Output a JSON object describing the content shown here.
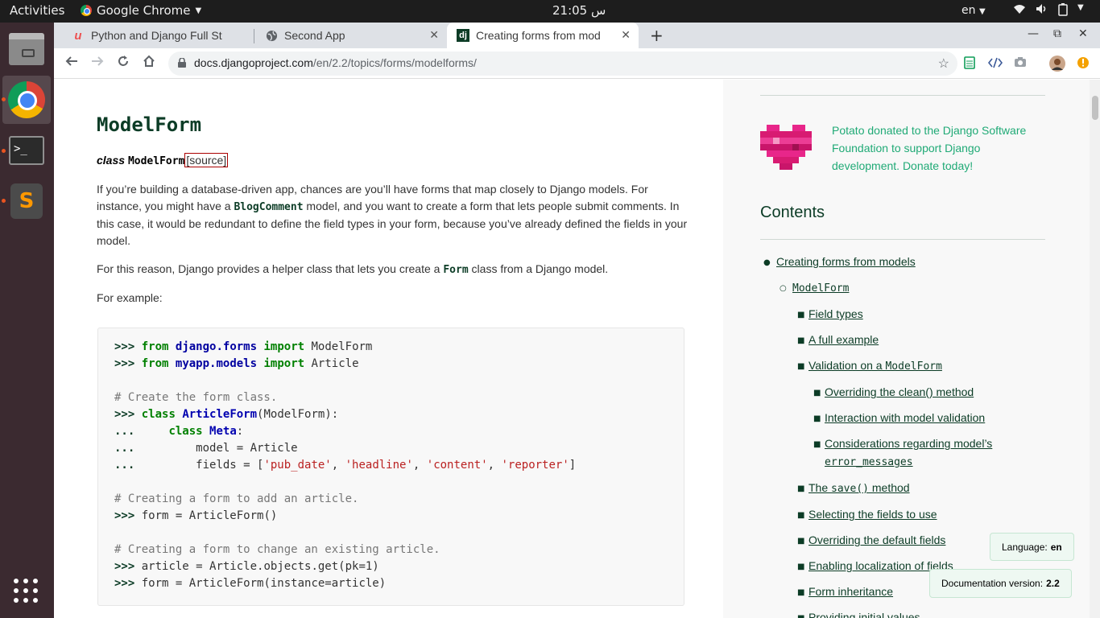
{
  "topbar": {
    "activities": "Activities",
    "app_name": "Google Chrome",
    "clock": "21:05 س",
    "lang": "en"
  },
  "browser": {
    "tabs": [
      {
        "title": "Python and Django Full St",
        "favicon": "udemy-icon"
      },
      {
        "title": "Second App",
        "favicon": "globe-icon"
      },
      {
        "title": "Creating forms from mod",
        "favicon": "django-icon"
      }
    ],
    "url_host": "docs.djangoproject.com",
    "url_path": "/en/2.2/topics/forms/modelforms/"
  },
  "main": {
    "heading": "ModelForm",
    "signature_kw": "class",
    "signature_name": "ModelForm",
    "signature_source": "[source]",
    "para1_a": "If you’re building a database-driven app, chances are you’ll have forms that map closely to Django models. For instance, you might have a ",
    "para1_code": "BlogComment",
    "para1_b": " model, and you want to create a form that lets people submit comments. In this case, it would be redundant to define the field types in your form, because you’ve already defined the fields in your model.",
    "para2_a": "For this reason, Django provides a helper class that lets you create a ",
    "para2_code": "Form",
    "para2_b": " class from a Django model.",
    "para3": "For example:",
    "code": {
      "l1_prompt": ">>>",
      "l1_kw1": "from",
      "l1_mod": "django.forms",
      "l1_kw2": "import",
      "l1_name": "ModelForm",
      "l2_prompt": ">>>",
      "l2_kw1": "from",
      "l2_mod": "myapp.models",
      "l2_kw2": "import",
      "l2_name": "Article",
      "l4_comment": "# Create the form class.",
      "l5_prompt": ">>>",
      "l5_kw": "class",
      "l5_cls": "ArticleForm",
      "l5_rest": "(ModelForm):",
      "l6_prompt": "...",
      "l6_kw": "class",
      "l6_cls": "Meta",
      "l6_rest": ":",
      "l7_prompt": "...",
      "l7_text": "model = Article",
      "l8_prompt": "...",
      "l8_text": "fields = [",
      "l8_s1": "'pub_date'",
      "l8_s2": "'headline'",
      "l8_s3": "'content'",
      "l8_s4": "'reporter'",
      "l10_comment": "# Creating a form to add an article.",
      "l11_prompt": ">>>",
      "l11_text": "form = ArticleForm()",
      "l13_comment": "# Creating a form to change an existing article.",
      "l14_prompt": ">>>",
      "l14_text": "article = Article.objects.get(pk=1)",
      "l15_prompt": ">>>",
      "l15_text": "form = ArticleForm(instance=article)"
    }
  },
  "side": {
    "donate": "Potato donated to the Django Software Foundation to support Django development. Donate today!",
    "contents_heading": "Contents",
    "toc": [
      {
        "label": "Creating forms from models"
      },
      {
        "label": "ModelForm"
      },
      {
        "label": "Field types"
      },
      {
        "label": "A full example"
      },
      {
        "label_a": "Validation on a ",
        "code": "ModelForm"
      },
      {
        "label": "Overriding the clean() method"
      },
      {
        "label": "Interaction with model validation"
      },
      {
        "label": "Considerations regarding model’s",
        "code": "error_messages"
      },
      {
        "label_a": "The ",
        "code": "save()",
        "label_b": " method"
      },
      {
        "label": "Selecting the fields to use"
      },
      {
        "label": "Overriding the default fields"
      },
      {
        "label": "Enabling localization of fields"
      },
      {
        "label": "Form inheritance"
      },
      {
        "label": "Providing initial values"
      }
    ],
    "language_label": "Language:",
    "language_value": "en",
    "docver_label": "Documentation version:",
    "docver_value": "2.2"
  },
  "colors": {
    "django_green": "#0c3c26",
    "link_green": "#20aa76",
    "dock_bg": "#3b2a30"
  }
}
